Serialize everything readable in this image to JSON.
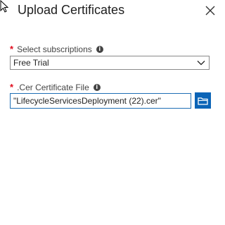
{
  "dialog": {
    "title": "Upload Certificates"
  },
  "icons": {
    "cursor": "mouse-pointer-icon",
    "close": "close-icon",
    "info": "info-icon",
    "chevron": "chevron-down-icon",
    "browse": "folder-icon"
  },
  "colors": {
    "required": "#e00b1c",
    "accent": "#0b64b7"
  },
  "subscriptions": {
    "required_mark": "*",
    "label": "Select subscriptions",
    "info_glyph": "i",
    "selected": "Free Trial"
  },
  "certificate": {
    "required_mark": "*",
    "label": ".Cer Certificate File",
    "info_glyph": "i",
    "value": "\"LifecycleServicesDeployment (22).cer\""
  }
}
